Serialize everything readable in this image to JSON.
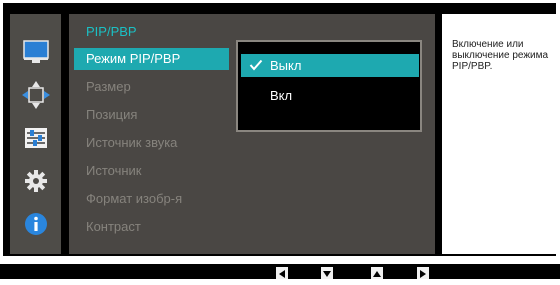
{
  "menu": {
    "title": "PIP/PBP",
    "items": [
      {
        "label": "Режим PIP/PBP",
        "selected": true
      },
      {
        "label": "Размер"
      },
      {
        "label": "Позиция"
      },
      {
        "label": "Источник звука"
      },
      {
        "label": "Источник"
      },
      {
        "label": "Формат изобр-я"
      },
      {
        "label": "Контраст"
      }
    ]
  },
  "submenu": {
    "options": [
      {
        "label": "Выкл",
        "selected": true
      },
      {
        "label": "Вкл"
      }
    ]
  },
  "help": {
    "text": "Включение или выключение режима PIP/PBP."
  },
  "sidebar_icons": [
    "display-icon",
    "arrows-move-icon",
    "sliders-icon",
    "gear-icon",
    "info-icon"
  ],
  "nav_buttons": [
    "left-button-icon",
    "down-button-icon",
    "up-button-icon",
    "right-button-icon"
  ],
  "colors": {
    "accent": "#1ea9b0",
    "title": "#1bc0c4",
    "panel": "#4a4744",
    "osd_bg": "#000000"
  }
}
